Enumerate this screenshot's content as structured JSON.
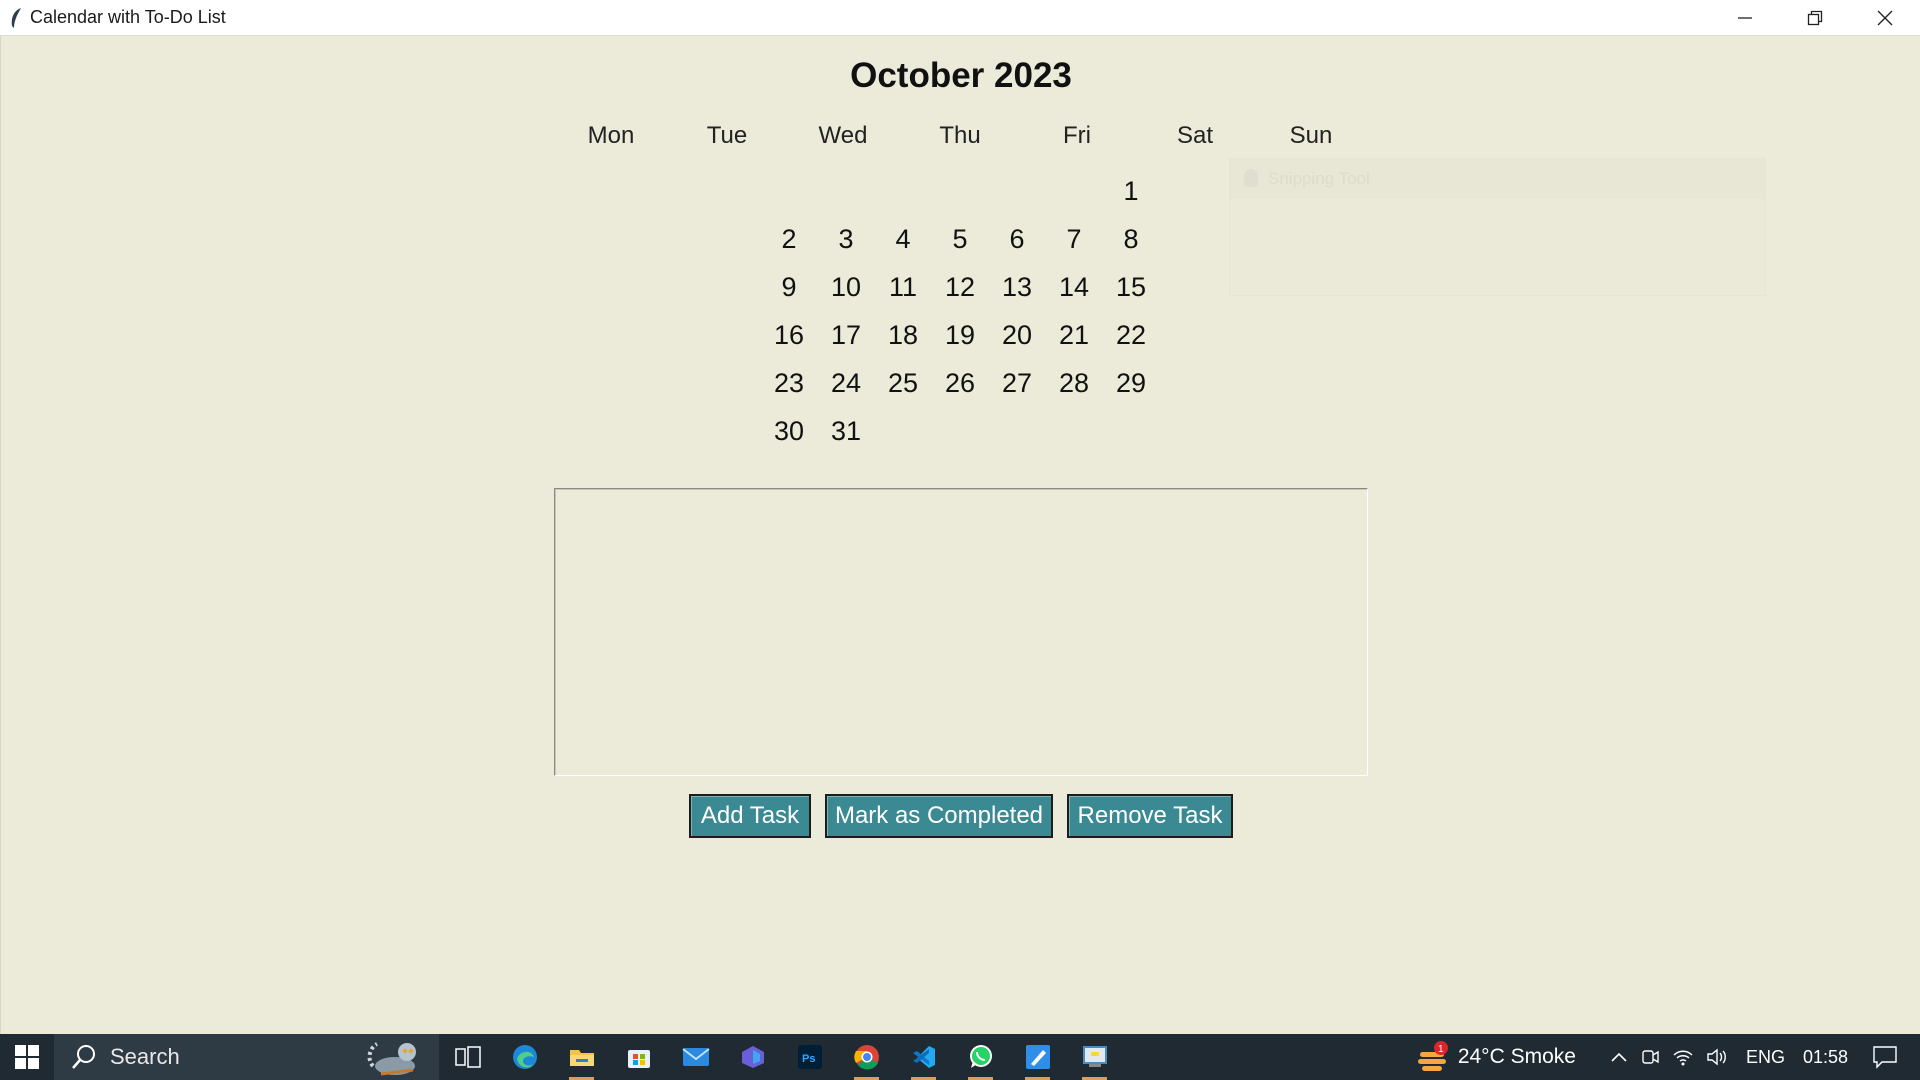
{
  "window": {
    "title": "Calendar with To-Do List"
  },
  "calendar": {
    "month_title": "October 2023",
    "weekdays": [
      "Mon",
      "Tue",
      "Wed",
      "Thu",
      "Fri",
      "Sat",
      "Sun"
    ],
    "days": [
      "1",
      "2",
      "3",
      "4",
      "5",
      "6",
      "7",
      "8",
      "9",
      "10",
      "11",
      "12",
      "13",
      "14",
      "15",
      "16",
      "17",
      "18",
      "19",
      "20",
      "21",
      "22",
      "23",
      "24",
      "25",
      "26",
      "27",
      "28",
      "29",
      "30",
      "31"
    ]
  },
  "ghost_overlay": {
    "text": "Snipping Tool"
  },
  "buttons": {
    "add_task": "Add Task",
    "mark_completed": "Mark as Completed",
    "remove_task": "Remove Task"
  },
  "colors": {
    "app_background": "#ecead9",
    "button_background": "#3b8a93",
    "button_text": "#ffffff",
    "taskbar": "#1f2a33"
  },
  "taskbar": {
    "search_label": "Search",
    "pinned_icons": [
      "task-view-icon",
      "edge-icon",
      "file-explorer-icon",
      "microsoft-store-icon",
      "mail-icon",
      "copilot-icon",
      "photoshop-icon",
      "chrome-icon",
      "vscode-icon",
      "whatsapp-icon",
      "pen-app-icon",
      "python-idle-icon"
    ],
    "weather": {
      "text": "24°C  Smoke",
      "badge": "1"
    },
    "language": "ENG",
    "time": "01:58"
  }
}
